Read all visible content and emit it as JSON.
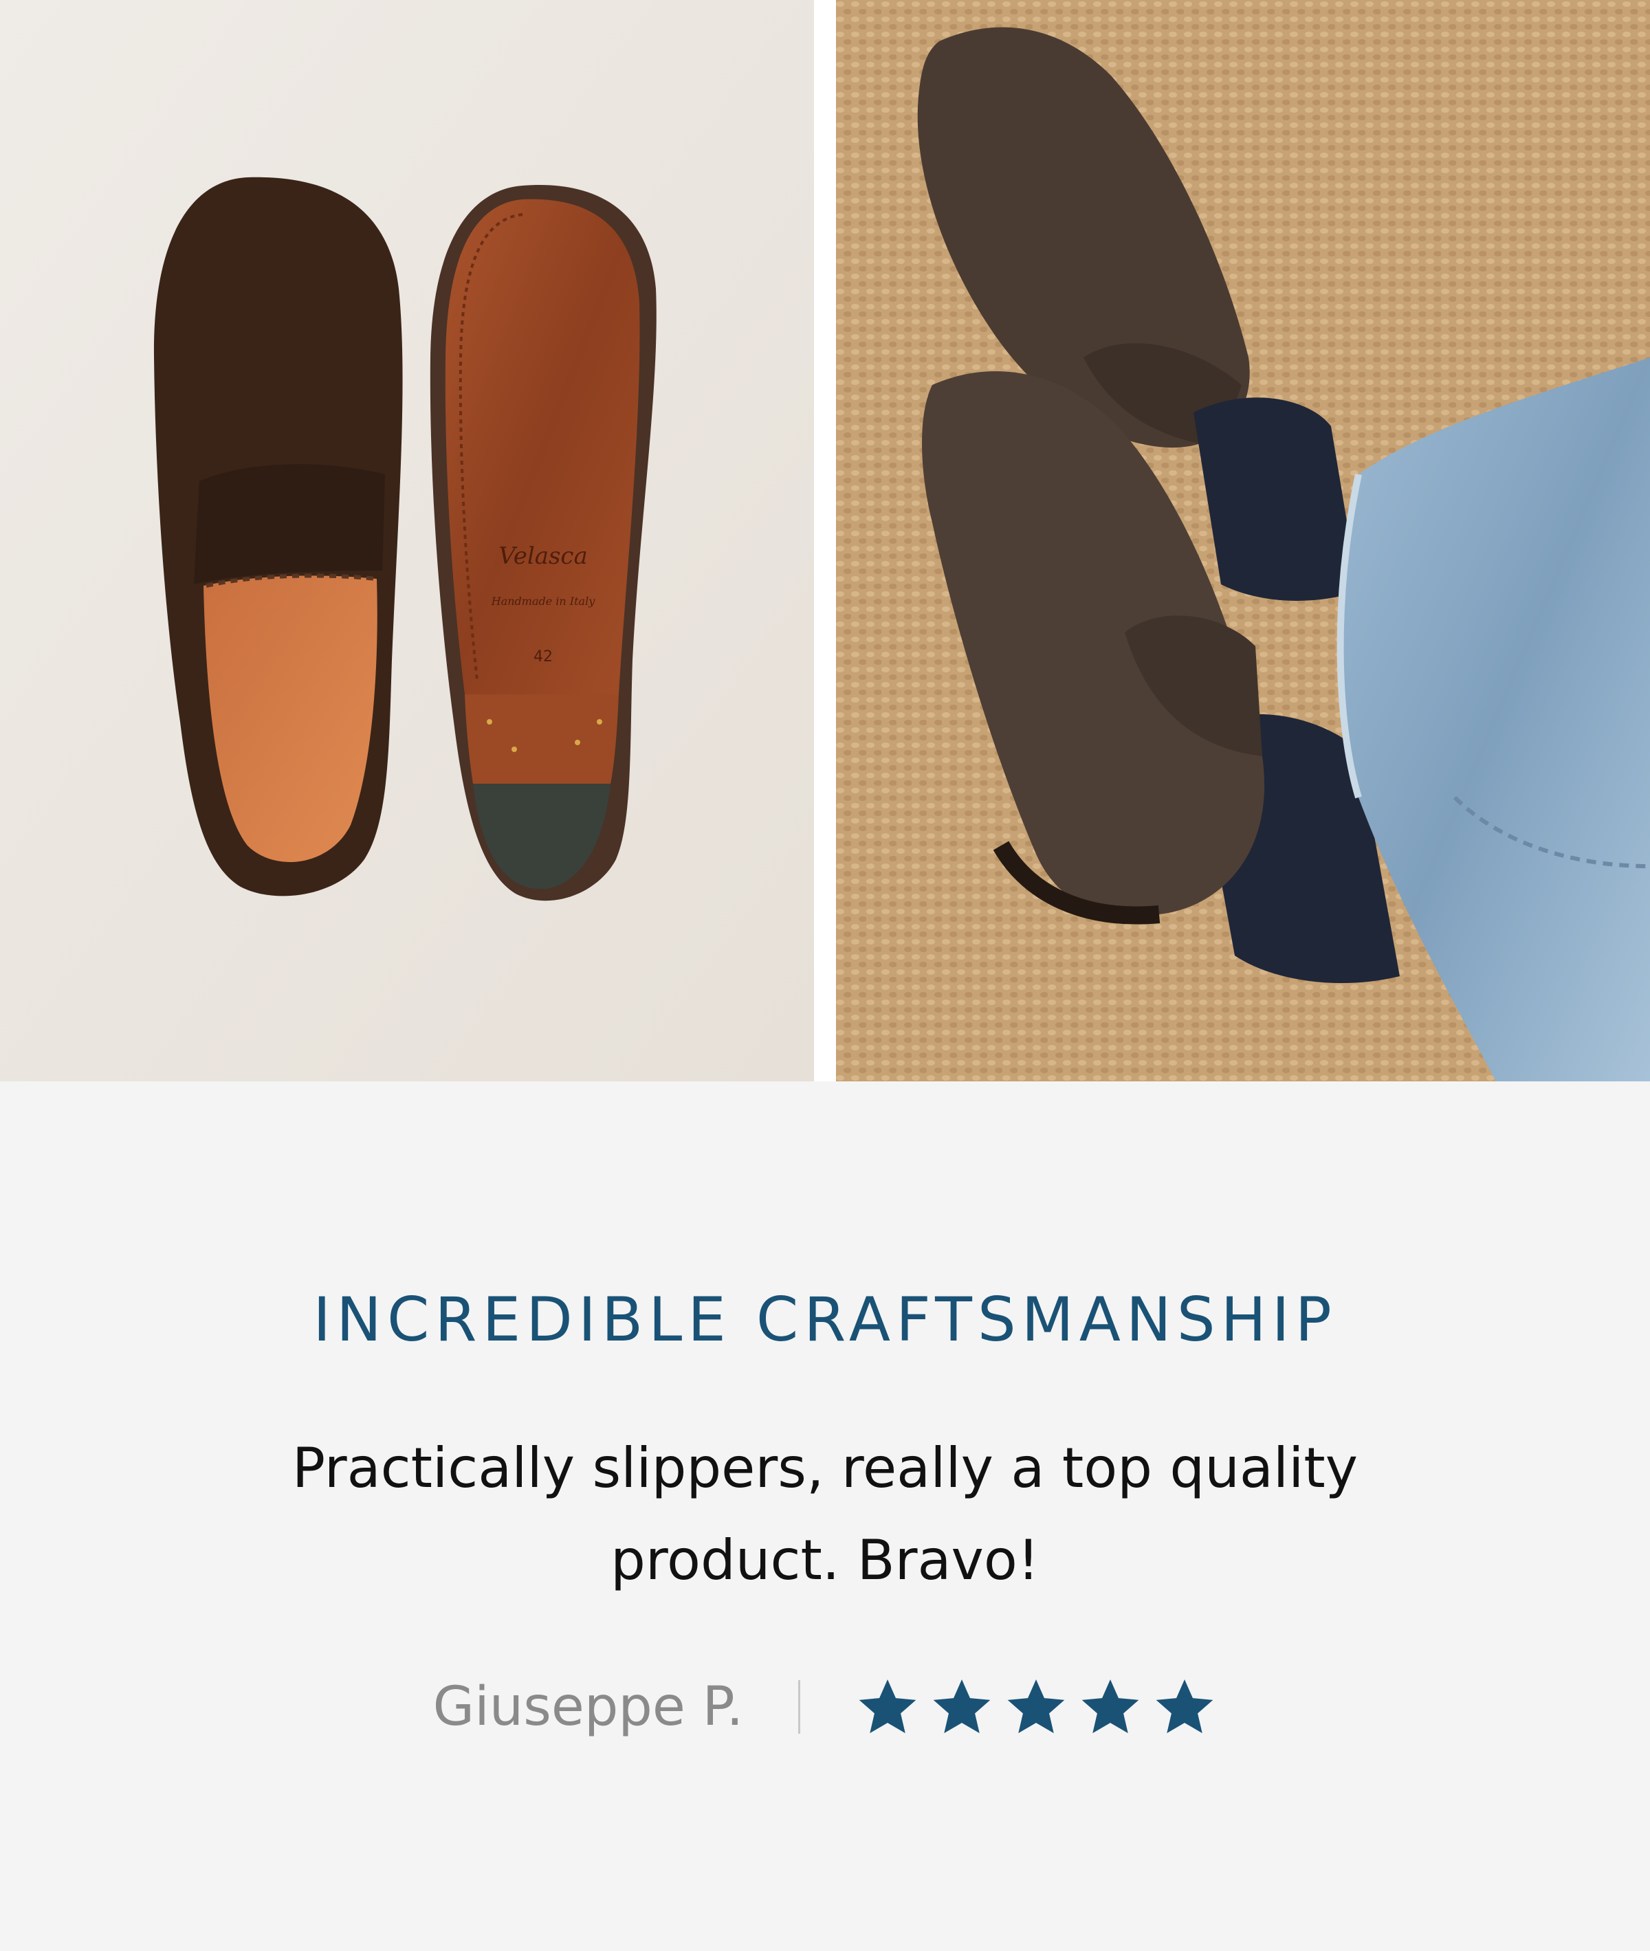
{
  "gallery": {
    "left_image_alt": "Brown suede penny loafers, top view and sole view",
    "left_sole_stamp": {
      "brand": "Velasca",
      "line1": "Handmade in Italy",
      "size": "42"
    },
    "right_image_alt": "Brown suede penny loafers worn with jeans and navy socks"
  },
  "review": {
    "title": "INCREDIBLE CRAFTSMANSHIP",
    "body": "Practically slippers, really a top quality product. Bravo!",
    "reviewer": "Giuseppe P.",
    "rating": 5,
    "rating_max": 5
  },
  "colors": {
    "accent": "#1a5276",
    "body_text": "#111111",
    "muted_text": "#8a8a8a",
    "background": "#f4f4f4"
  },
  "icons": {
    "rating": "star-icon"
  }
}
